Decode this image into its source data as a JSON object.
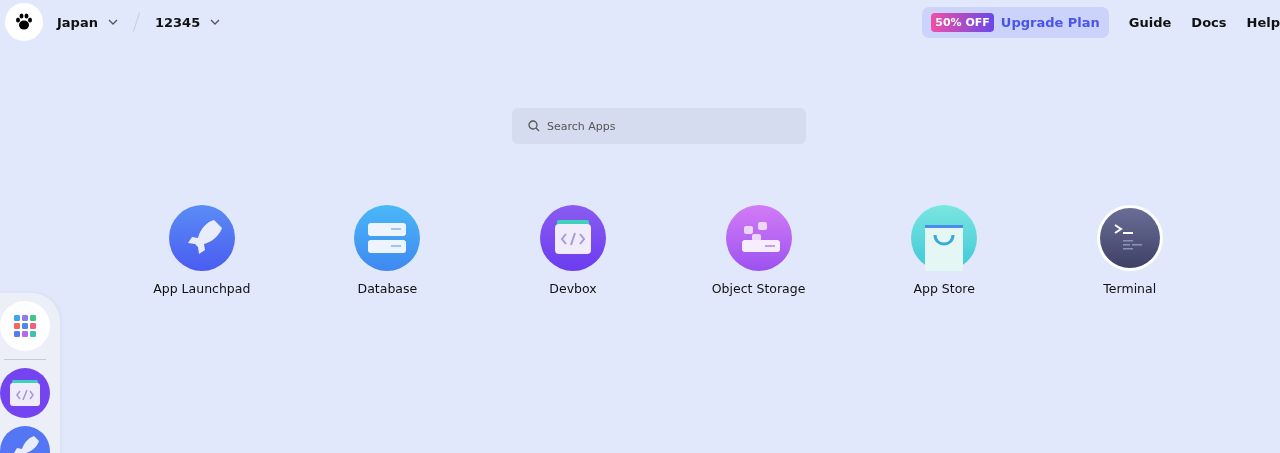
{
  "header": {
    "region": "Japan",
    "workspace": "12345",
    "promo": {
      "badge": "50% OFF",
      "label": "Upgrade Plan"
    },
    "links": [
      "Guide",
      "Docs",
      "Help"
    ]
  },
  "search": {
    "placeholder": "Search Apps"
  },
  "apps": [
    {
      "kind": "launchpad",
      "label": "App Launchpad"
    },
    {
      "kind": "database",
      "label": "Database"
    },
    {
      "kind": "devbox",
      "label": "Devbox"
    },
    {
      "kind": "storage",
      "label": "Object Storage"
    },
    {
      "kind": "store",
      "label": "App Store"
    },
    {
      "kind": "terminal",
      "label": "Terminal"
    }
  ],
  "dock": [
    {
      "kind": "grid"
    },
    {
      "kind": "devbox"
    },
    {
      "kind": "launchpad"
    }
  ]
}
